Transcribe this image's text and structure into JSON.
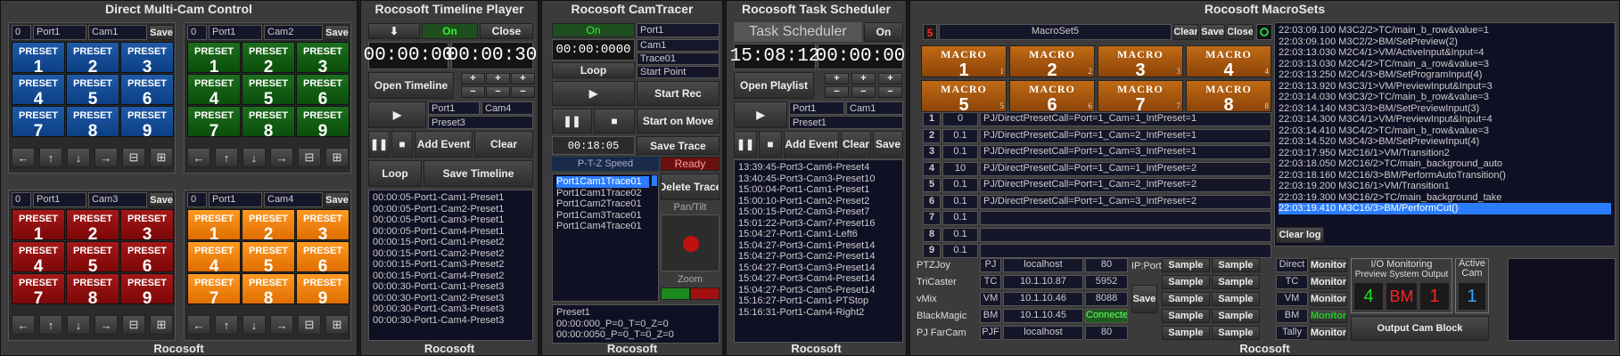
{
  "p1": {
    "title": "Direct Multi-Cam Control",
    "footer": "Rocosoft",
    "blocks": [
      {
        "num": "0",
        "port": "Port1",
        "cam": "Cam1",
        "save": "Save",
        "color": "blue"
      },
      {
        "num": "0",
        "port": "Port1",
        "cam": "Cam2",
        "save": "Save",
        "color": "green"
      },
      {
        "num": "0",
        "port": "Port1",
        "cam": "Cam3",
        "save": "Save",
        "color": "red"
      },
      {
        "num": "0",
        "port": "Port1",
        "cam": "Cam4",
        "save": "Save",
        "color": "orange"
      }
    ],
    "preset_label": "PRESET",
    "nav": [
      "←",
      "↑",
      "↓",
      "→",
      "⊟",
      "⊞"
    ]
  },
  "p2": {
    "title": "Rocosoft Timeline Player",
    "footer": "Rocosoft",
    "down": "⬇",
    "on": "On",
    "close": "Close",
    "time1": "00:00:00",
    "time2": "00:00:30",
    "open_timeline": "Open Timeline",
    "plus": "+",
    "minus": "−",
    "play": "▶",
    "port": "Port1",
    "cam": "Cam4",
    "preset": "Preset3",
    "pause": "❚❚",
    "stop": "■",
    "add_event": "Add Event",
    "clear": "Clear",
    "loop": "Loop",
    "save_timeline": "Save Timeline",
    "items": [
      "00:00:05-Port1-Cam1-Preset1",
      "00:00:05-Port1-Cam2-Preset1",
      "00:00:05-Port1-Cam3-Preset1",
      "00:00:05-Port1-Cam4-Preset1",
      "00:00:15-Port1-Cam1-Preset2",
      "00:00:15-Port1-Cam2-Preset2",
      "00:00:15-Port1-Cam3-Preset2",
      "00:00:15-Port1-Cam4-Preset2",
      "00:00:30-Port1-Cam1-Preset3",
      "00:00:30-Port1-Cam2-Preset3",
      "00:00:30-Port1-Cam3-Preset3",
      "00:00:30-Port1-Cam4-Preset3"
    ]
  },
  "p3": {
    "title": "Rocosoft CamTracer",
    "footer": "Rocosoft",
    "on": "On",
    "port": "Port1",
    "time": "00:00:0000",
    "cam": "Cam1",
    "trace": "Trace01",
    "loop": "Loop",
    "start_point": "Start Point",
    "play": "▶",
    "start_rec": "Start Rec",
    "pause": "❚❚",
    "stop": "■",
    "start_on_move": "Start on Move",
    "elapsed": "00:18:05",
    "save_trace": "Save Trace",
    "ptz_speed": "P-T-Z Speed",
    "ready": "Ready",
    "traces": [
      "Port1Cam1Trace01",
      "Port1Cam1Trace02",
      "Port1Cam2Trace01",
      "Port1Cam3Trace01",
      "Port1Cam4Trace01"
    ],
    "delete_trace": "Delete Trace",
    "pan_tilt": "Pan/Tilt",
    "zoom": "Zoom",
    "info": [
      "Preset1",
      "00:00:000_P=0_T=0_Z=0",
      "00:00:0050_P=0_T=0_Z=0"
    ]
  },
  "p4": {
    "title": "Rocosoft Task Scheduler",
    "footer": "Rocosoft",
    "task_label": "Task Scheduler",
    "on": "On",
    "clock": "15:08:12",
    "timer": "00:00:00",
    "open_playlist": "Open Playlist",
    "plus": "+",
    "minus": "−",
    "play": "▶",
    "port": "Port1",
    "cam": "Cam1",
    "preset": "Preset1",
    "pause": "❚❚",
    "stop": "■",
    "add_event": "Add Event",
    "clear": "Clear",
    "save": "Save",
    "items": [
      "13:39:45-Port3-Cam6-Preset4",
      "13:40:45-Port3-Cam3-Preset10",
      "15:00:04-Port1-Cam1-Preset1",
      "15:00:10-Port1-Cam2-Preset2",
      "15:00:15-Port2-Cam3-Preset7",
      "15:01:22-Port3-Cam7-Preset16",
      "15:04:27-Port1-Cam1-Left6",
      "15:04:27-Port3-Cam1-Preset14",
      "15:04:27-Port3-Cam2-Preset14",
      "15:04:27-Port3-Cam3-Preset14",
      "15:04:27-Port3-Cam4-Preset14",
      "15:04:27-Port3-Cam5-Preset14",
      "15:16:27-Port1-Cam1-PTStop",
      "15:16:31-Port1-Cam4-Right2"
    ]
  },
  "p5": {
    "title": "Rocosoft MacroSets",
    "footer": "Rocosoft",
    "num": "5",
    "name": "MacroSet5",
    "clear": "Clear",
    "save": "Save",
    "close": "Close",
    "macro_label": "MACRO",
    "rows": [
      {
        "n": "1",
        "d": "0",
        "cmd": "PJ/DirectPresetCall=Port=1_Cam=1_IntPreset=1"
      },
      {
        "n": "2",
        "d": "0.1",
        "cmd": "PJ/DirectPresetCall=Port=1_Cam=2_IntPreset=1"
      },
      {
        "n": "3",
        "d": "0.1",
        "cmd": "PJ/DirectPresetCall=Port=1_Cam=3_IntPreset=1"
      },
      {
        "n": "4",
        "d": "10",
        "cmd": "PJ/DirectPresetCall=Port=1_Cam=1_IntPreset=2"
      },
      {
        "n": "5",
        "d": "0.1",
        "cmd": "PJ/DirectPresetCall=Port=1_Cam=2_IntPreset=2"
      },
      {
        "n": "6",
        "d": "0.1",
        "cmd": "PJ/DirectPresetCall=Port=1_Cam=3_IntPreset=2"
      },
      {
        "n": "7",
        "d": "0.1",
        "cmd": ""
      },
      {
        "n": "8",
        "d": "0.1",
        "cmd": ""
      },
      {
        "n": "9",
        "d": "0.1",
        "cmd": ""
      }
    ],
    "ip_port": "IP:Port",
    "sample": "Sample",
    "save_btn": "Save",
    "devices": [
      {
        "name": "PTZJoy",
        "code": "PJ",
        "host": "localhost",
        "port": "80"
      },
      {
        "name": "TriCaster",
        "code": "TC",
        "host": "10.1.10.87",
        "port": "5952"
      },
      {
        "name": "vMix",
        "code": "VM",
        "host": "10.1.10.46",
        "port": "8088"
      },
      {
        "name": "BlackMagic",
        "code": "BM",
        "host": "10.1.10.45",
        "port": "Connected"
      },
      {
        "name": "PJ  FarCam",
        "code": "PJF",
        "host": "localhost",
        "port": "80"
      }
    ],
    "log": [
      "22:03:09.100 M3C2/2>TC/main_b_row&value=1",
      "22:03:09.100 M3C2/2>BM/SetPreview(2)",
      "22:03:13.030 M2C4/1>VM/ActiveInput&Input=4",
      "22:03:13.030 M2C4/2>TC/main_a_row&value=3",
      "22:03:13.250 M2C4/3>BM/SetProgramInput(4)",
      "22:03:13.920 M3C3/1>VM/PreviewInput&Input=3",
      "22:03:14.030 M3C3/2>TC/main_b_row&value=3",
      "22:03:14.140 M3C3/3>BM/SetPreviewInput(3)",
      "22:03:14.300 M3C4/1>VM/PreviewInput&Input=4",
      "22:03:14.410 M3C4/2>TC/main_b_row&value=3",
      "22:03:14.520 M3C4/3>BM/SetPreviewInput(4)",
      "22:03:17.950 M2C16/1>VM/Transition2",
      "22:03:18.050 M2C16/2>TC/main_background_auto",
      "22:03:18.160 M2C16/3>BM/PerformAutoTransition()",
      "22:03:19.200 M3C16/1>VM/Transition1",
      "22:03:19.300 M3C16/2>TC/main_background_take",
      "22:03:19.410 M3C16/3>BM/PerformCut()"
    ],
    "clear_log": "Clear log",
    "io_items": [
      {
        "label": "Direct",
        "btn": "Monitor"
      },
      {
        "label": "TC",
        "btn": "Monitor"
      },
      {
        "label": "VM",
        "btn": "Monitor"
      },
      {
        "label": "BM",
        "btn": "Monitor"
      },
      {
        "label": "Tally",
        "btn": "Monitor"
      }
    ],
    "io_title": "I/O Monitoring",
    "io_cols": "Preview  System  Output",
    "io_vals": {
      "preview": "4",
      "system": "BM",
      "output": "1"
    },
    "active_cam_label": "Active Cam",
    "active_cam": "1",
    "output_cam_block": "Output Cam Block"
  },
  "colors": {
    "blue": "#0c3f84",
    "green": "#0b4e0b",
    "red": "#7c0707",
    "orange": "#e06e00",
    "macro": "#8c4408",
    "accent": "#2a7dff"
  }
}
